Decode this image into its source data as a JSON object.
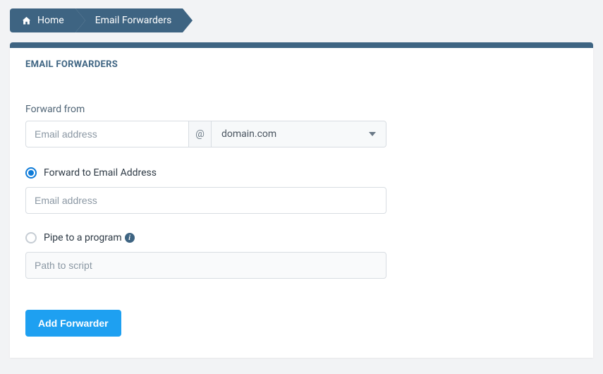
{
  "breadcrumb": {
    "home": "Home",
    "current": "Email Forwarders"
  },
  "panel": {
    "title": "EMAIL FORWARDERS"
  },
  "forward_from": {
    "label": "Forward from",
    "placeholder": "Email address",
    "at_symbol": "@",
    "domain": "domain.com"
  },
  "options": {
    "forward_to": {
      "label": "Forward to Email Address",
      "placeholder": "Email address",
      "selected": true
    },
    "pipe": {
      "label": "Pipe to a program",
      "placeholder": "Path to script",
      "selected": false
    }
  },
  "submit": {
    "label": "Add Forwarder"
  }
}
